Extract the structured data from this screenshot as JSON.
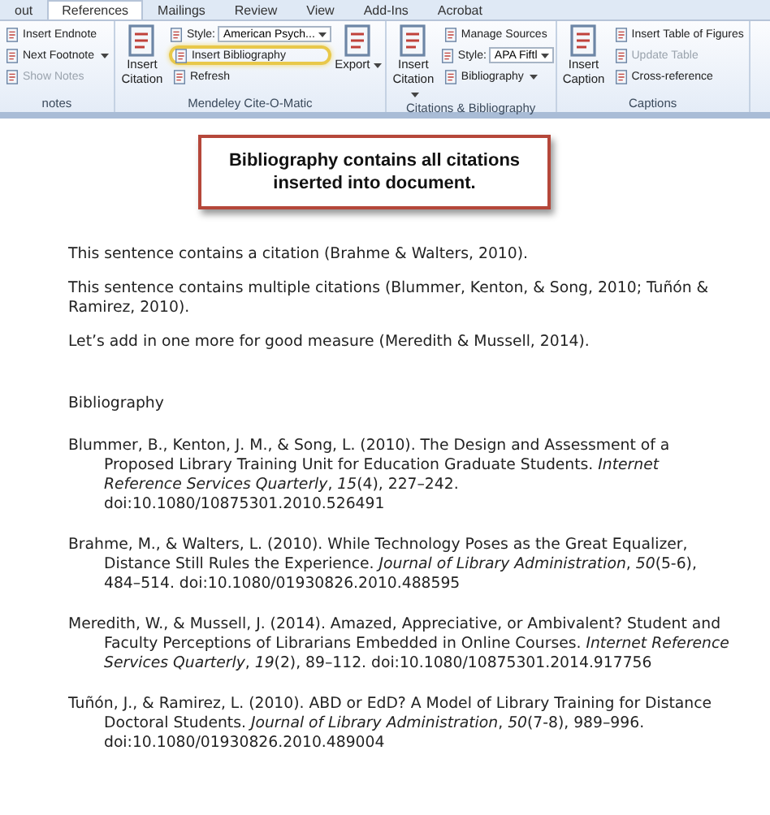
{
  "tabs": [
    {
      "label": "out",
      "selected": false
    },
    {
      "label": "References",
      "selected": true
    },
    {
      "label": "Mailings",
      "selected": false
    },
    {
      "label": "Review",
      "selected": false
    },
    {
      "label": "View",
      "selected": false
    },
    {
      "label": "Add-Ins",
      "selected": false
    },
    {
      "label": "Acrobat",
      "selected": false
    }
  ],
  "groups": [
    {
      "label": "notes",
      "columns": [
        [
          {
            "kind": "small",
            "label": "Insert Endnote",
            "menu": false,
            "disabled": false,
            "highlighted": false
          },
          {
            "kind": "small",
            "label": "Next Footnote",
            "menu": true,
            "disabled": false,
            "highlighted": false
          },
          {
            "kind": "small",
            "label": "Show Notes",
            "menu": false,
            "disabled": true,
            "highlighted": false
          }
        ]
      ]
    },
    {
      "label": "Mendeley Cite-O-Matic",
      "columns": [
        [
          {
            "kind": "large",
            "label": "Insert Citation",
            "menu": false,
            "disabled": false,
            "highlighted": false
          }
        ],
        [
          {
            "kind": "combo",
            "label": "Style:",
            "value": "American Psych...",
            "menu": true,
            "disabled": false,
            "highlighted": false
          },
          {
            "kind": "small",
            "label": "Insert Bibliography",
            "menu": false,
            "disabled": false,
            "highlighted": true
          },
          {
            "kind": "small",
            "label": "Refresh",
            "menu": false,
            "disabled": false,
            "highlighted": false
          }
        ],
        [
          {
            "kind": "large",
            "label": "Export",
            "menu": true,
            "disabled": false,
            "highlighted": false
          }
        ]
      ]
    },
    {
      "label": "Citations & Bibliography",
      "columns": [
        [
          {
            "kind": "large",
            "label": "Insert Citation",
            "menu": true,
            "disabled": false,
            "highlighted": false
          }
        ],
        [
          {
            "kind": "small",
            "label": "Manage Sources",
            "menu": false,
            "disabled": false,
            "highlighted": false
          },
          {
            "kind": "combo",
            "label": "Style:",
            "value": "APA Fiftl",
            "menu": true,
            "disabled": false,
            "highlighted": false
          },
          {
            "kind": "small",
            "label": "Bibliography",
            "menu": true,
            "disabled": false,
            "highlighted": false
          }
        ]
      ]
    },
    {
      "label": "Captions",
      "columns": [
        [
          {
            "kind": "large",
            "label": "Insert Caption",
            "menu": false,
            "disabled": false,
            "highlighted": false
          }
        ],
        [
          {
            "kind": "small",
            "label": "Insert Table of Figures",
            "menu": false,
            "disabled": false,
            "highlighted": false
          },
          {
            "kind": "small",
            "label": "Update Table",
            "menu": false,
            "disabled": true,
            "highlighted": false
          },
          {
            "kind": "small",
            "label": "Cross-reference",
            "menu": false,
            "disabled": false,
            "highlighted": false
          }
        ]
      ]
    }
  ],
  "callout": "Bibliography contains all citations inserted into document.",
  "paragraphs": [
    "This sentence contains a citation (Brahme & Walters, 2010).",
    "This sentence contains multiple citations (Blummer, Kenton, & Song, 2010; Tuñón & Ramirez, 2010).",
    "Let’s add in one more for good measure (Meredith & Mussell, 2014)."
  ],
  "bibliography": {
    "heading": "Bibliography",
    "entries": [
      "Blummer, B., Kenton, J. M., & Song, L. (2010). The Design and Assessment of a Proposed Library Training Unit for Education Graduate Students. *Internet Reference Services Quarterly*, *15*(4), 227–242. doi:10.1080/10875301.2010.526491",
      "Brahme, M., & Walters, L. (2010). While Technology Poses as the Great Equalizer, Distance Still Rules the Experience. *Journal of Library Administration*, *50*(5-6), 484–514. doi:10.1080/01930826.2010.488595",
      "Meredith, W., & Mussell, J. (2014). Amazed, Appreciative, or Ambivalent? Student and Faculty Perceptions of Librarians Embedded in Online Courses. *Internet Reference Services Quarterly*, *19*(2), 89–112. doi:10.1080/10875301.2014.917756",
      "Tuñón, J., & Ramirez, L. (2010). ABD or EdD? A Model of Library Training for Distance Doctoral Students. *Journal of Library Administration*, *50*(7-8), 989–996. doi:10.1080/01930826.2010.489004"
    ]
  }
}
